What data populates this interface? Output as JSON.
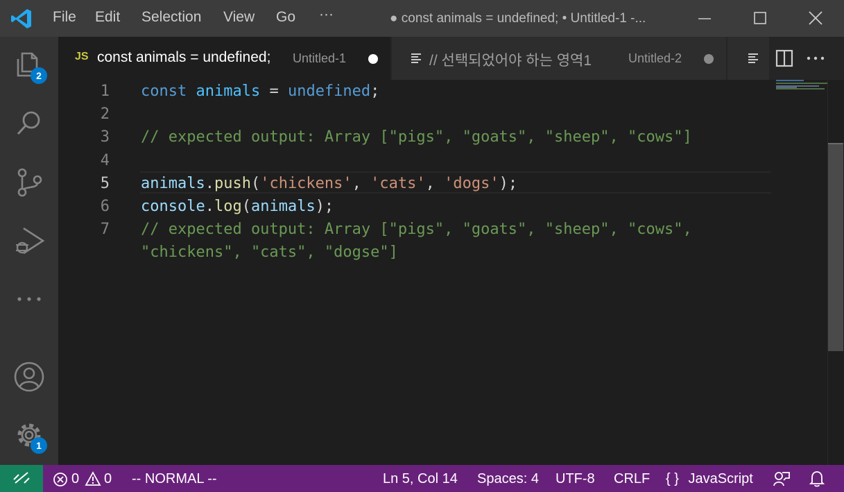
{
  "window": {
    "title": "● const animals = undefined; • Untitled-1 -...",
    "menu": [
      "File",
      "Edit",
      "Selection",
      "View",
      "Go",
      "···"
    ]
  },
  "activity_bar": {
    "explorer_badge": "2",
    "settings_badge": "1"
  },
  "tabs": [
    {
      "icon": "JS",
      "title": "const animals = undefined;",
      "description": "Untitled-1",
      "dirty": true,
      "active": true
    },
    {
      "icon": "lines",
      "title": "// 선택되었어야 하는 영역1",
      "description": "Untitled-2",
      "dirty": true,
      "active": false
    }
  ],
  "editor": {
    "line_numbers": [
      "1",
      "2",
      "3",
      "4",
      "5",
      "6",
      "7",
      ""
    ],
    "current_line": 5
  },
  "status_bar": {
    "errors": "0",
    "warnings": "0",
    "mode": "-- NORMAL --",
    "cursor": "Ln 5, Col 14",
    "indent": "Spaces: 4",
    "encoding": "UTF-8",
    "eol": "CRLF",
    "language_icon": "{ }",
    "language": "JavaScript"
  },
  "colors": {
    "status_bar": "#68217a",
    "remote": "#16825d",
    "accent": "#007acc"
  }
}
